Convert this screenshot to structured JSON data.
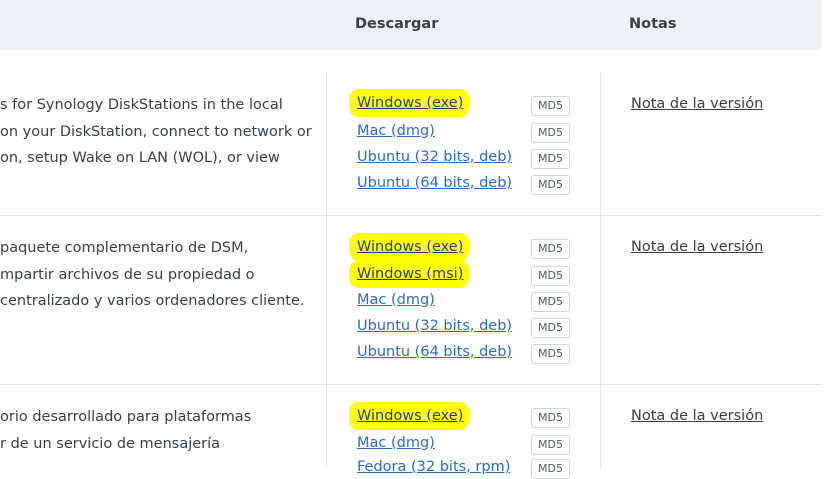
{
  "header": {
    "download": "Descargar",
    "notes": "Notas"
  },
  "rows": [
    {
      "desc": [
        "s for Synology DiskStations in the local",
        "on your DiskStation, connect to network or",
        "on, setup Wake on LAN (WOL), or view"
      ],
      "downloads": [
        {
          "label": "Windows (exe)",
          "md5": "MD5",
          "highlight": true
        },
        {
          "label": "Mac (dmg)",
          "md5": "MD5",
          "highlight": false
        },
        {
          "label": "Ubuntu (32 bits, deb)",
          "md5": "MD5",
          "highlight": false
        },
        {
          "label": "Ubuntu (64 bits, deb)",
          "md5": "MD5",
          "highlight": false
        }
      ],
      "note": "Nota de la versión"
    },
    {
      "desc": [
        "paquete complementario de DSM,",
        "mpartir archivos de su propiedad o",
        "centralizado y varios ordenadores cliente."
      ],
      "downloads": [
        {
          "label": "Windows (exe)",
          "md5": "MD5",
          "highlight": true
        },
        {
          "label": "Windows (msi)",
          "md5": "MD5",
          "highlight": true
        },
        {
          "label": "Mac (dmg)",
          "md5": "MD5",
          "highlight": false
        },
        {
          "label": "Ubuntu (32 bits, deb)",
          "md5": "MD5",
          "highlight": false
        },
        {
          "label": "Ubuntu (64 bits, deb)",
          "md5": "MD5",
          "highlight": false
        }
      ],
      "note": "Nota de la versión"
    },
    {
      "desc": [
        "orio desarrollado para plataformas",
        "r de un servicio de mensajería"
      ],
      "downloads": [
        {
          "label": "Windows (exe)",
          "md5": "MD5",
          "highlight": true
        },
        {
          "label": "Mac (dmg)",
          "md5": "MD5",
          "highlight": false
        },
        {
          "label": "Fedora (32 bits, rpm)",
          "md5": "MD5",
          "highlight": false
        }
      ],
      "note": "Nota de la versión"
    }
  ],
  "colors": {
    "link": "#2a6bc7",
    "highlight": "#ffff00",
    "header_bg": "#eef1f4"
  }
}
